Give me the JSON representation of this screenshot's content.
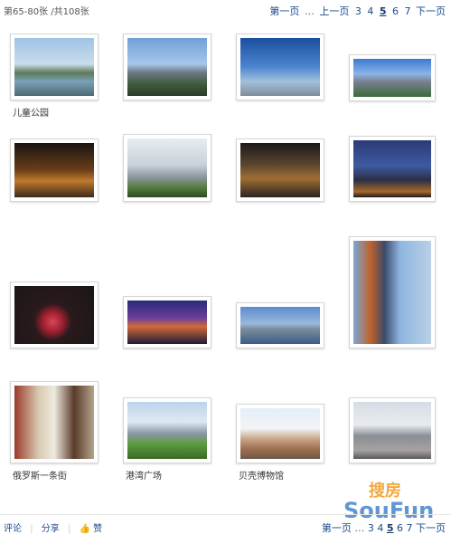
{
  "header": {
    "count": "第65-80张  /共108张",
    "pager": {
      "first": "第一页",
      "ellipsis": "…",
      "prev": "上一页",
      "pages": [
        "3",
        "4",
        "5",
        "6",
        "7"
      ],
      "current": "5",
      "next": "下一页"
    }
  },
  "captions": {
    "t1": "儿童公园",
    "t13": "俄罗斯一条街",
    "t14": "港湾广场",
    "t15": "贝壳博物馆"
  },
  "footer": {
    "comment": "评论",
    "share": "分享",
    "like": "赞",
    "pager": {
      "first": "第一页",
      "ellipsis": "…",
      "pages": [
        "3",
        "4",
        "5",
        "6",
        "7"
      ],
      "current": "5",
      "next": "下一页"
    }
  },
  "watermark": {
    "cn": "搜房",
    "en": "SouFun"
  },
  "colors": {
    "link": "#1a4a8a",
    "watermark_orange": "#f39a1e",
    "watermark_blue": "#2b74c8"
  }
}
